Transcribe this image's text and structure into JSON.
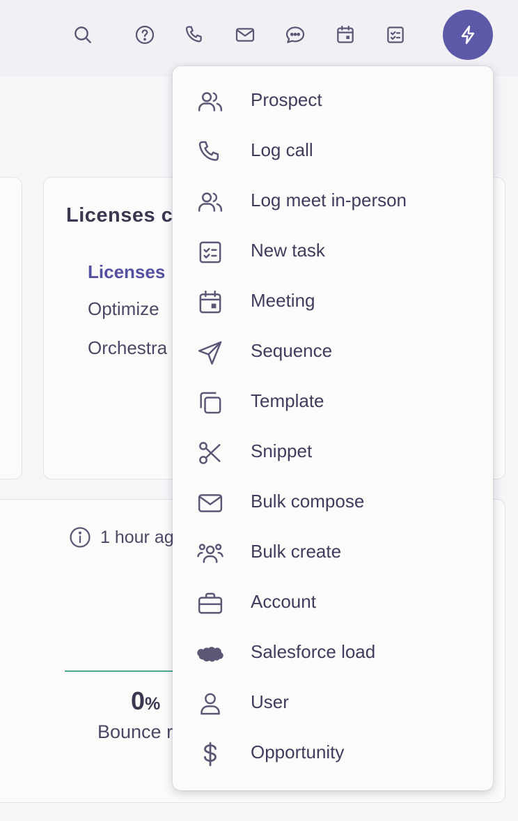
{
  "colors": {
    "accent": "#5c5aa8",
    "icon": "#5a5874",
    "text": "#3f3d5c",
    "link_active": "#5451a1",
    "success_line": "#4ea68d",
    "menu_bg": "#fcfbfa",
    "page_bg": "#f6f5f8"
  },
  "topbar": {
    "icons": [
      "search-icon",
      "help-icon",
      "phone-icon",
      "mail-icon",
      "chat-icon",
      "calendar-icon",
      "task-icon"
    ],
    "quick_action_icon": "lightning-icon"
  },
  "card": {
    "title": "Licenses c",
    "rows": [
      "Licenses",
      "Optimize",
      "Orchestra"
    ]
  },
  "bottom_card": {
    "updated_text": "1 hour ag",
    "stat_value": "0",
    "stat_unit": "%",
    "stat_label": "Bounce r"
  },
  "menu": {
    "items": [
      {
        "label": "Prospect",
        "icon": "people-icon"
      },
      {
        "label": "Log call",
        "icon": "phone-icon"
      },
      {
        "label": "Log meet in-person",
        "icon": "people-icon"
      },
      {
        "label": "New task",
        "icon": "task-icon"
      },
      {
        "label": "Meeting",
        "icon": "calendar-icon"
      },
      {
        "label": "Sequence",
        "icon": "send-icon"
      },
      {
        "label": "Template",
        "icon": "copy-icon"
      },
      {
        "label": "Snippet",
        "icon": "scissors-icon"
      },
      {
        "label": "Bulk compose",
        "icon": "mail-icon"
      },
      {
        "label": "Bulk create",
        "icon": "group-icon"
      },
      {
        "label": "Account",
        "icon": "briefcase-icon"
      },
      {
        "label": "Salesforce load",
        "icon": "cloud-icon"
      },
      {
        "label": "User",
        "icon": "user-icon"
      },
      {
        "label": "Opportunity",
        "icon": "dollar-icon"
      }
    ]
  }
}
